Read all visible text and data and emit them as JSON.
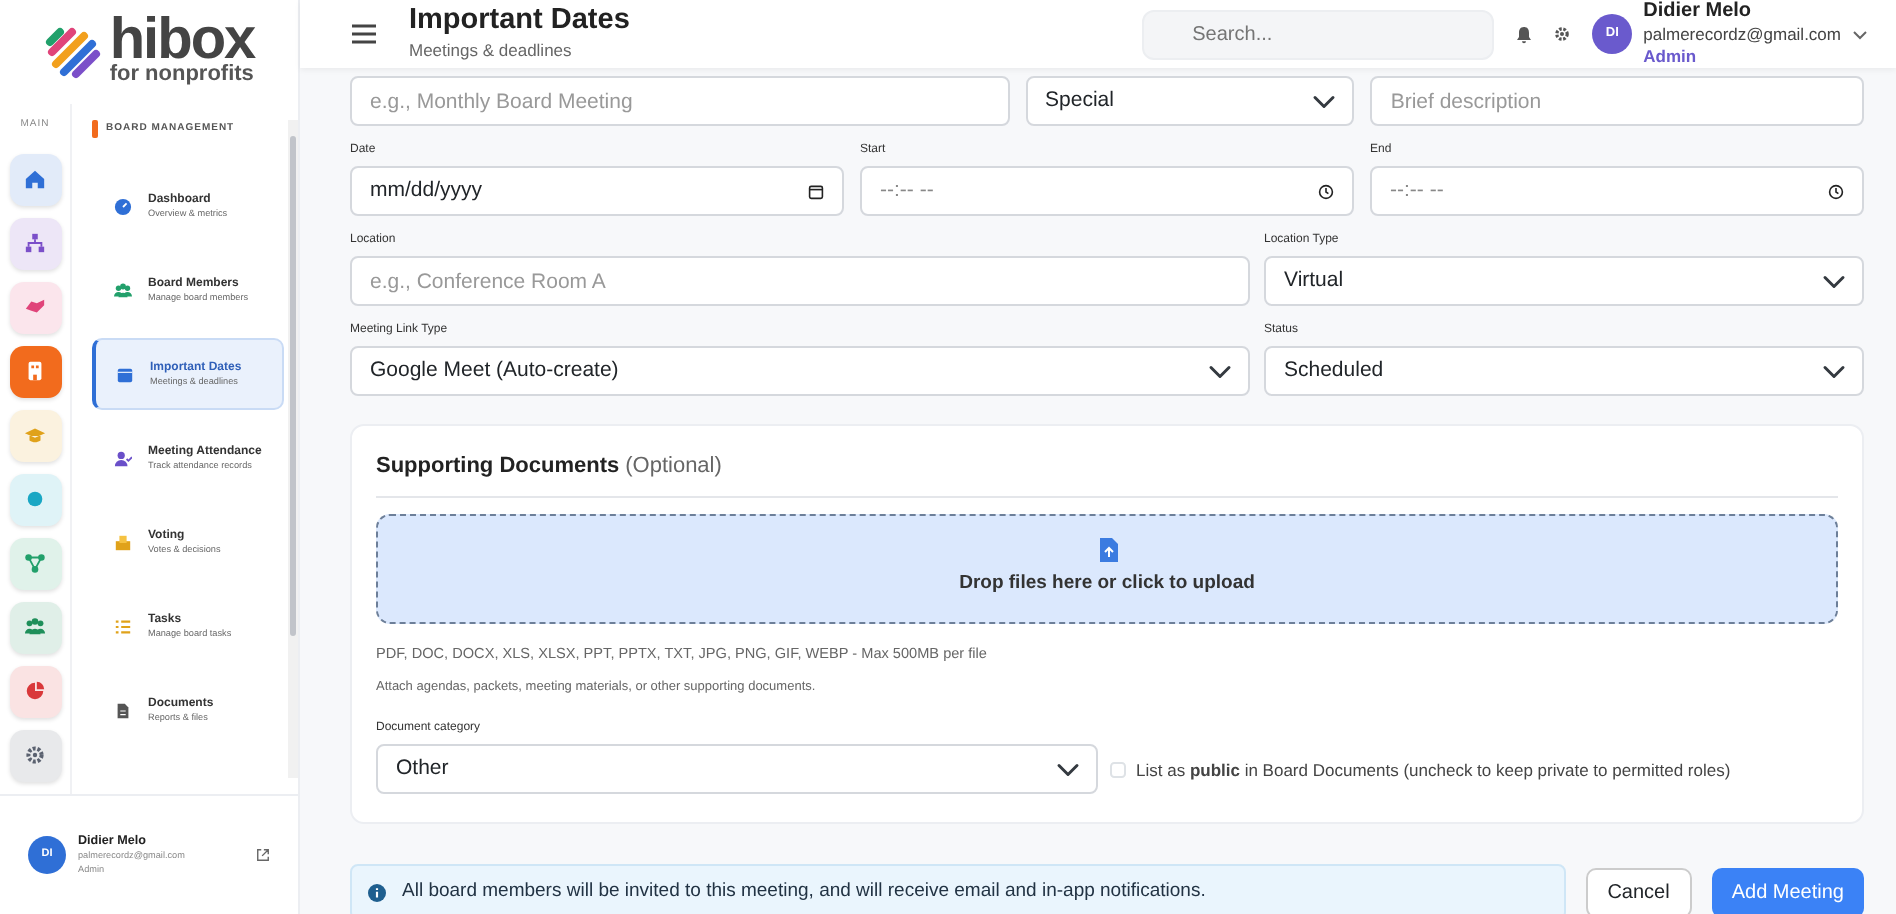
{
  "logo": {
    "name": "hibox",
    "tagline": "for nonprofits"
  },
  "rail": {
    "label": "MAIN",
    "items": [
      {
        "kind": "home",
        "color": "#2f6fd6",
        "selected": false
      },
      {
        "kind": "org",
        "color": "#7b4fc9",
        "selected": false
      },
      {
        "kind": "handshake",
        "color": "#e0447a",
        "selected": false
      },
      {
        "kind": "building",
        "color": "#f26b1d",
        "selected": true
      },
      {
        "kind": "cap",
        "color": "#e0a21a",
        "selected": false
      },
      {
        "kind": "dot",
        "color": "#1aa7c4",
        "selected": false
      },
      {
        "kind": "share",
        "color": "#22a06b",
        "selected": false
      },
      {
        "kind": "users",
        "color": "#1f8f5a",
        "selected": false
      },
      {
        "kind": "pie",
        "color": "#d9383a",
        "selected": false
      },
      {
        "kind": "gear",
        "color": "#5b6270",
        "selected": false
      }
    ]
  },
  "submenu": {
    "heading": "BOARD MANAGEMENT",
    "items": [
      {
        "kind": "gauge",
        "title": "Dashboard",
        "subtitle": "Overview & metrics",
        "selected": false
      },
      {
        "kind": "users",
        "title": "Board Members",
        "subtitle": "Manage board members",
        "selected": false
      },
      {
        "kind": "calendar",
        "title": "Important Dates",
        "subtitle": "Meetings & deadlines",
        "selected": true
      },
      {
        "kind": "usercheck",
        "title": "Meeting Attendance",
        "subtitle": "Track attendance records",
        "selected": false
      },
      {
        "kind": "vote",
        "title": "Voting",
        "subtitle": "Votes & decisions",
        "selected": false
      },
      {
        "kind": "tasks",
        "title": "Tasks",
        "subtitle": "Manage board tasks",
        "selected": false
      },
      {
        "kind": "file",
        "title": "Documents",
        "subtitle": "Reports & files",
        "selected": false
      }
    ]
  },
  "sidebar_user": {
    "initials": "DI",
    "name": "Didier Melo",
    "email": "palmerecordz@gmail.com",
    "role": "Admin"
  },
  "header": {
    "title": "Important Dates",
    "subtitle": "Meetings & deadlines",
    "search": {
      "placeholder": "Search..."
    },
    "user": {
      "initials": "DI",
      "name": "Didier Melo",
      "email": "palmerecordz@gmail.com",
      "role": "Admin"
    }
  },
  "form": {
    "top_row": [
      {
        "kind": "input",
        "placeholder": "e.g., Monthly Board Meeting"
      },
      {
        "kind": "select",
        "value": "Special"
      },
      {
        "kind": "input",
        "placeholder": "Brief description"
      }
    ],
    "rows": [
      {
        "fields": [
          {
            "kind": "date",
            "label": "Date",
            "value": "mm/dd/yyyy"
          },
          {
            "kind": "time",
            "label": "Start",
            "placeholder": "--:-- --"
          },
          {
            "kind": "time",
            "label": "End",
            "placeholder": "--:-- --"
          }
        ]
      },
      {
        "fields": [
          {
            "kind": "input",
            "label": "Location",
            "placeholder": "e.g., Conference Room A"
          },
          {
            "kind": "select",
            "label": "Location Type",
            "value": "Virtual"
          }
        ]
      },
      {
        "fields": [
          {
            "kind": "select",
            "label": "Meeting Link Type",
            "value": "Google Meet (Auto-create)"
          },
          {
            "kind": "select",
            "label": "Status",
            "value": "Scheduled"
          }
        ]
      }
    ]
  },
  "documents": {
    "title": "Supporting Documents",
    "optional": "(Optional)",
    "drop_text": "Drop files here or click to upload",
    "formats": "PDF, DOC, DOCX, XLS, XLSX, PPT, PPTX, TXT, JPG, PNG, GIF, WEBP - Max 500MB per file",
    "hint": "Attach agendas, packets, meeting materials, or other supporting documents.",
    "category": {
      "label": "Document category",
      "value": "Other"
    },
    "public": {
      "label": "List as **public** in Board Documents (uncheck to keep private to permitted roles)",
      "checked": false
    }
  },
  "notice": "All board members will be invited to this meeting, and will receive email and in-app notifications.",
  "buttons": [
    {
      "kind": "secondary",
      "label": "Cancel"
    },
    {
      "kind": "primary",
      "label": "Add Meeting"
    }
  ]
}
